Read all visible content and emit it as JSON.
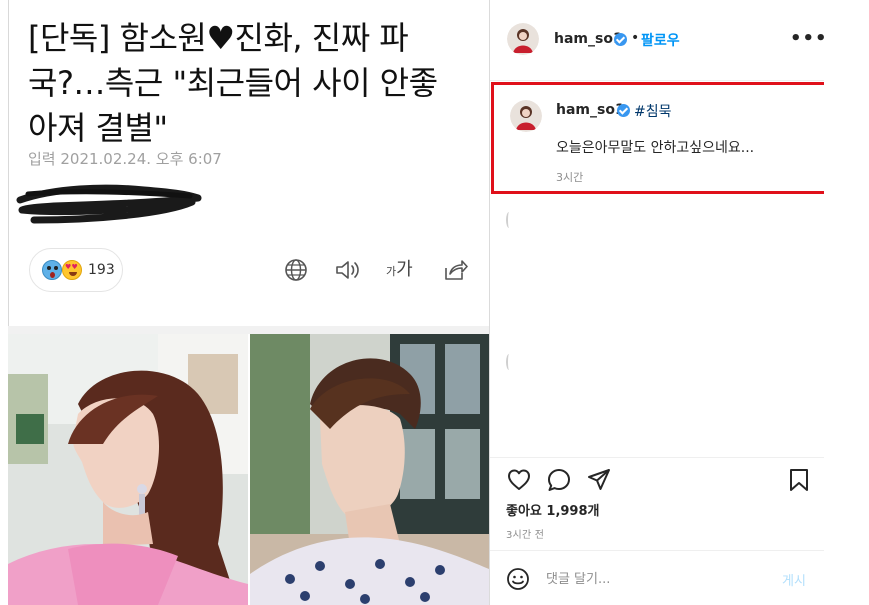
{
  "article": {
    "headline_lines": [
      "[단독] 함소원♥진화, 진짜 파",
      "국?…측근 \"최근들어 사이 안좋",
      "아져 결별\""
    ],
    "dateline": "입력 2021.02.24. 오후 6:07",
    "reactions": {
      "count": "193",
      "icons": [
        "surprised-emoji",
        "heart-eyes-emoji"
      ]
    },
    "toolbar": {
      "translate_icon": "globe-icon",
      "listen_icon": "speaker-icon",
      "font_label_small": "가",
      "font_label_large": "가",
      "share_icon": "share-icon"
    }
  },
  "instagram": {
    "header": {
      "username": "ham_so1",
      "separator": "•",
      "follow_label": "팔로우",
      "more_label": "•••"
    },
    "caption": {
      "username": "ham_so1",
      "hashtag": "#침묵",
      "text": "오늘은아무말도 안하고싶으네요...",
      "time": "3시간"
    },
    "likes": "좋아요 1,998개",
    "post_time": "3시간 전",
    "comment": {
      "placeholder": "댓글 달기...",
      "post_label": "게시"
    }
  },
  "colors": {
    "highlight_border": "#e0101a",
    "link_blue": "#0095f6",
    "verified_blue": "#3897f0",
    "hashtag_blue": "#00376b",
    "muted_text": "#8e8e8e"
  }
}
